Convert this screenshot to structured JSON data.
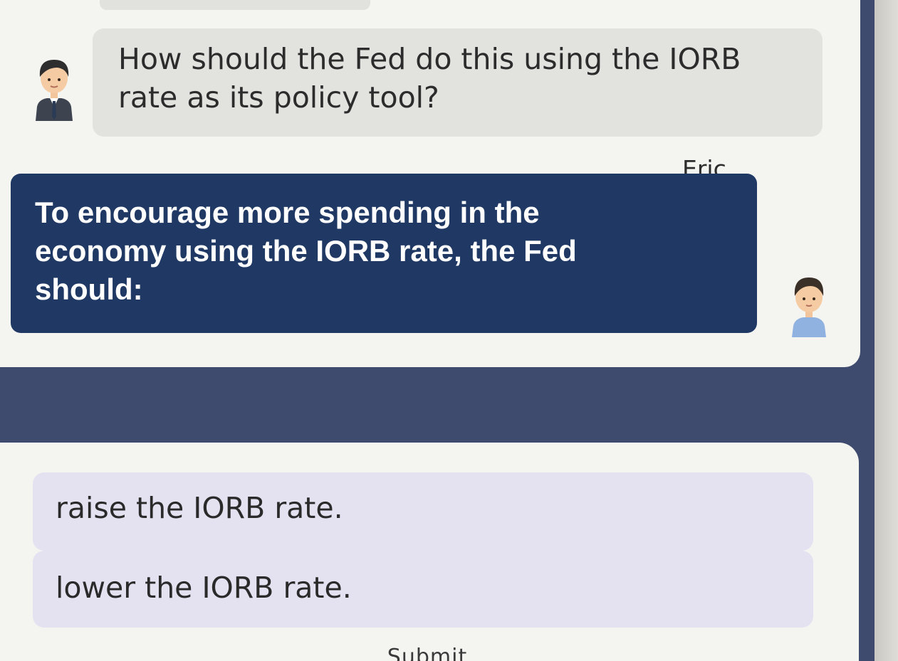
{
  "chat": {
    "question": "How should the Fed do this using the IORB rate as its policy tool?",
    "sender_name": "Eric",
    "answer_prompt": "To encourage more spending in the economy using the IORB rate, the Fed should:"
  },
  "choices": [
    {
      "label": "raise the IORB rate."
    },
    {
      "label": "lower the IORB rate."
    }
  ],
  "actions": {
    "submit_label": "Submit"
  },
  "icons": {
    "tutor_avatar": "tutor-avatar-icon",
    "student_avatar": "student-avatar-icon"
  },
  "colors": {
    "app_background": "#3e4b6e",
    "answer_bubble": "#1f3864",
    "question_bubble": "#e2e2df",
    "choice_background": "#e4e2f1"
  }
}
